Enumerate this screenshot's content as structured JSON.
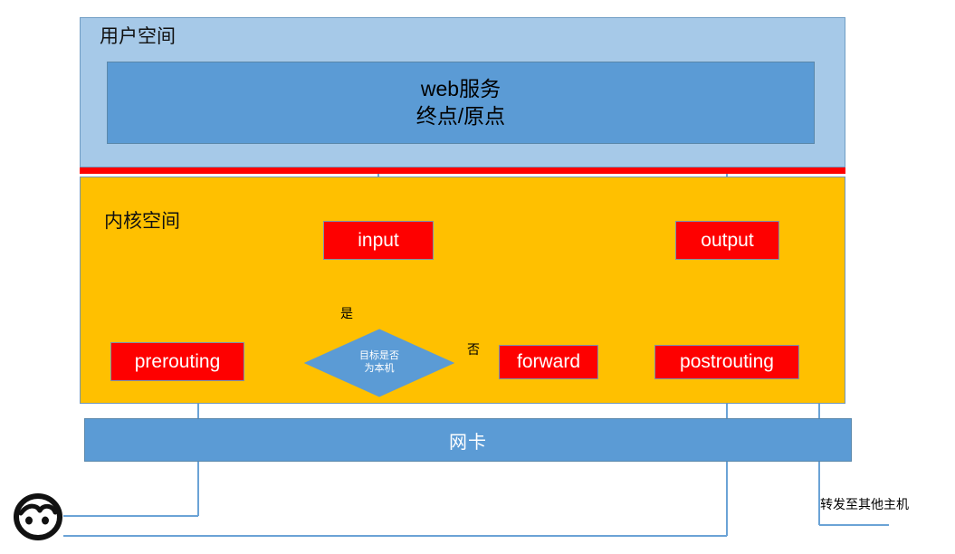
{
  "diagram": {
    "title": "netfilter packet flow",
    "colors": {
      "userspace_bg": "#a6c9e8",
      "kernelspace_bg": "#ffc000",
      "divider": "#fe0000",
      "chain_box": "#fe0000",
      "service_box": "#5b9bd5",
      "nic_box": "#5b9bd5",
      "diamond": "#5b9bd5",
      "connector": "#6ba3d6",
      "arrow": "#4a8fcf"
    }
  },
  "userspace": {
    "title": "用户空间",
    "service_box": {
      "line1": "web服务",
      "line2": "终点/原点"
    }
  },
  "kernelspace": {
    "title": "内核空间",
    "chains": {
      "input": "input",
      "output": "output",
      "prerouting": "prerouting",
      "forward": "forward",
      "postrouting": "postrouting"
    },
    "decision": {
      "line1": "目标是否",
      "line2": "为本机",
      "yes_label": "是",
      "no_label": "否"
    }
  },
  "nic": {
    "label": "网卡"
  },
  "annotations": {
    "forward_to_other_host": "转发至其他主机"
  },
  "icons": {
    "face": "angry-face-icon"
  }
}
